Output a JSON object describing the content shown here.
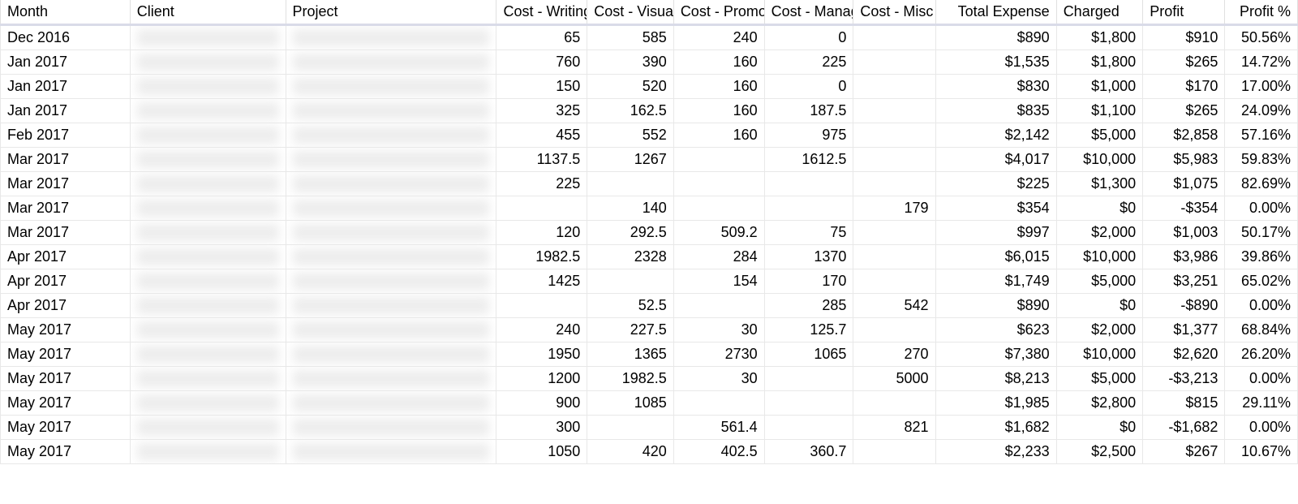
{
  "headers": {
    "month": "Month",
    "client": "Client",
    "project": "Project",
    "cost_writing": "Cost - Writing",
    "cost_visual": "Cost - Visual",
    "cost_promo": "Cost - Promo",
    "cost_manag": "Cost - Manag",
    "cost_misc": "Cost - Misc",
    "total_expense": "Total Expense",
    "charged": "Charged",
    "profit": "Profit",
    "profit_pct": "Profit %"
  },
  "rows": [
    {
      "month": "Dec 2016",
      "cost_writing": "65",
      "cost_visual": "585",
      "cost_promo": "240",
      "cost_manag": "0",
      "cost_misc": "",
      "total_expense": "$890",
      "charged": "$1,800",
      "profit": "$910",
      "profit_pct": "50.56%"
    },
    {
      "month": "Jan 2017",
      "cost_writing": "760",
      "cost_visual": "390",
      "cost_promo": "160",
      "cost_manag": "225",
      "cost_misc": "",
      "total_expense": "$1,535",
      "charged": "$1,800",
      "profit": "$265",
      "profit_pct": "14.72%"
    },
    {
      "month": "Jan 2017",
      "cost_writing": "150",
      "cost_visual": "520",
      "cost_promo": "160",
      "cost_manag": "0",
      "cost_misc": "",
      "total_expense": "$830",
      "charged": "$1,000",
      "profit": "$170",
      "profit_pct": "17.00%"
    },
    {
      "month": "Jan 2017",
      "cost_writing": "325",
      "cost_visual": "162.5",
      "cost_promo": "160",
      "cost_manag": "187.5",
      "cost_misc": "",
      "total_expense": "$835",
      "charged": "$1,100",
      "profit": "$265",
      "profit_pct": "24.09%"
    },
    {
      "month": "Feb 2017",
      "cost_writing": "455",
      "cost_visual": "552",
      "cost_promo": "160",
      "cost_manag": "975",
      "cost_misc": "",
      "total_expense": "$2,142",
      "charged": "$5,000",
      "profit": "$2,858",
      "profit_pct": "57.16%"
    },
    {
      "month": "Mar 2017",
      "cost_writing": "1137.5",
      "cost_visual": "1267",
      "cost_promo": "",
      "cost_manag": "1612.5",
      "cost_misc": "",
      "total_expense": "$4,017",
      "charged": "$10,000",
      "profit": "$5,983",
      "profit_pct": "59.83%"
    },
    {
      "month": "Mar 2017",
      "cost_writing": "225",
      "cost_visual": "",
      "cost_promo": "",
      "cost_manag": "",
      "cost_misc": "",
      "total_expense": "$225",
      "charged": "$1,300",
      "profit": "$1,075",
      "profit_pct": "82.69%"
    },
    {
      "month": "Mar 2017",
      "cost_writing": "",
      "cost_visual": "140",
      "cost_promo": "",
      "cost_manag": "",
      "cost_misc": "179",
      "total_expense": "$354",
      "charged": "$0",
      "profit": "-$354",
      "profit_pct": "0.00%"
    },
    {
      "month": "Mar 2017",
      "cost_writing": "120",
      "cost_visual": "292.5",
      "cost_promo": "509.2",
      "cost_manag": "75",
      "cost_misc": "",
      "total_expense": "$997",
      "charged": "$2,000",
      "profit": "$1,003",
      "profit_pct": "50.17%"
    },
    {
      "month": "Apr 2017",
      "cost_writing": "1982.5",
      "cost_visual": "2328",
      "cost_promo": "284",
      "cost_manag": "1370",
      "cost_misc": "",
      "total_expense": "$6,015",
      "charged": "$10,000",
      "profit": "$3,986",
      "profit_pct": "39.86%"
    },
    {
      "month": "Apr 2017",
      "cost_writing": "1425",
      "cost_visual": "",
      "cost_promo": "154",
      "cost_manag": "170",
      "cost_misc": "",
      "total_expense": "$1,749",
      "charged": "$5,000",
      "profit": "$3,251",
      "profit_pct": "65.02%"
    },
    {
      "month": "Apr 2017",
      "cost_writing": "",
      "cost_visual": "52.5",
      "cost_promo": "",
      "cost_manag": "285",
      "cost_misc": "542",
      "total_expense": "$890",
      "charged": "$0",
      "profit": "-$890",
      "profit_pct": "0.00%"
    },
    {
      "month": "May 2017",
      "cost_writing": "240",
      "cost_visual": "227.5",
      "cost_promo": "30",
      "cost_manag": "125.7",
      "cost_misc": "",
      "total_expense": "$623",
      "charged": "$2,000",
      "profit": "$1,377",
      "profit_pct": "68.84%"
    },
    {
      "month": "May 2017",
      "cost_writing": "1950",
      "cost_visual": "1365",
      "cost_promo": "2730",
      "cost_manag": "1065",
      "cost_misc": "270",
      "total_expense": "$7,380",
      "charged": "$10,000",
      "profit": "$2,620",
      "profit_pct": "26.20%"
    },
    {
      "month": "May 2017",
      "cost_writing": "1200",
      "cost_visual": "1982.5",
      "cost_promo": "30",
      "cost_manag": "",
      "cost_misc": "5000",
      "total_expense": "$8,213",
      "charged": "$5,000",
      "profit": "-$3,213",
      "profit_pct": "0.00%"
    },
    {
      "month": "May 2017",
      "cost_writing": "900",
      "cost_visual": "1085",
      "cost_promo": "",
      "cost_manag": "",
      "cost_misc": "",
      "total_expense": "$1,985",
      "charged": "$2,800",
      "profit": "$815",
      "profit_pct": "29.11%"
    },
    {
      "month": "May 2017",
      "cost_writing": "300",
      "cost_visual": "",
      "cost_promo": "561.4",
      "cost_manag": "",
      "cost_misc": "821",
      "total_expense": "$1,682",
      "charged": "$0",
      "profit": "-$1,682",
      "profit_pct": "0.00%"
    },
    {
      "month": "May 2017",
      "cost_writing": "1050",
      "cost_visual": "420",
      "cost_promo": "402.5",
      "cost_manag": "360.7",
      "cost_misc": "",
      "total_expense": "$2,233",
      "charged": "$2,500",
      "profit": "$267",
      "profit_pct": "10.67%"
    }
  ]
}
